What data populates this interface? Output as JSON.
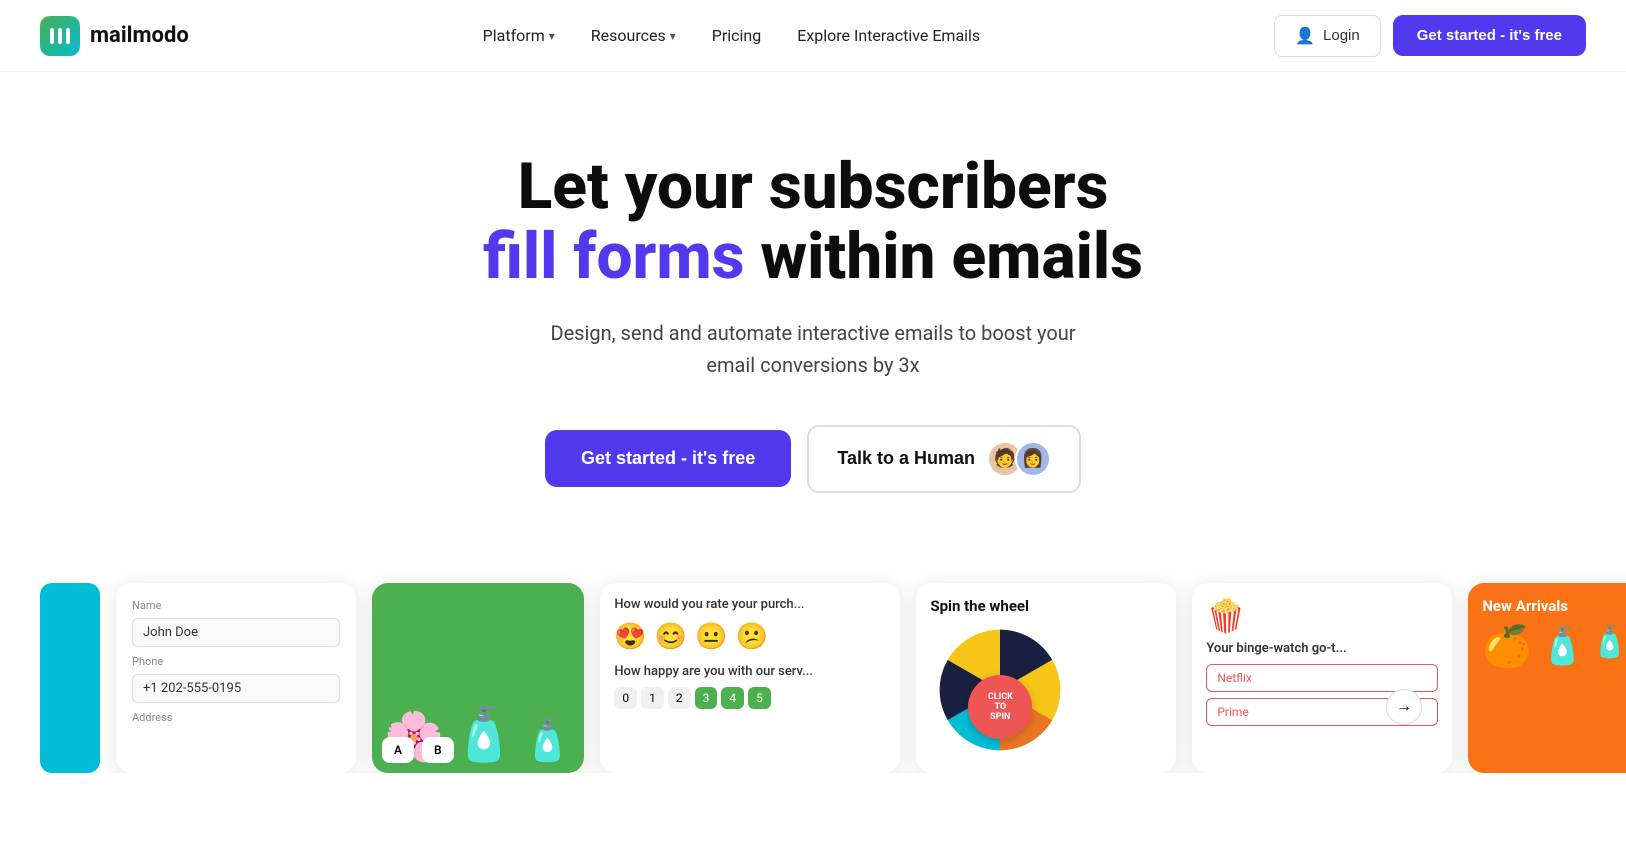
{
  "nav": {
    "logo_text": "mailmodo",
    "links": [
      {
        "label": "Platform",
        "has_dropdown": true
      },
      {
        "label": "Resources",
        "has_dropdown": true
      },
      {
        "label": "Pricing",
        "has_dropdown": false
      },
      {
        "label": "Explore Interactive Emails",
        "has_dropdown": false
      }
    ],
    "login_label": "Login",
    "cta_label": "Get started - it's free"
  },
  "hero": {
    "title_line1": "Let your subscribers",
    "title_highlight": "fill forms",
    "title_line2": "within emails",
    "subtitle": "Design, send and automate interactive emails to boost your email conversions by 3x",
    "cta_primary": "Get started - it's free",
    "cta_secondary": "Talk to a Human"
  },
  "cards": [
    {
      "type": "form",
      "label_name": "Name",
      "value_name": "John Doe",
      "label_phone": "Phone",
      "value_phone": "+1 202-555-0195",
      "label_address": "Address"
    },
    {
      "type": "product",
      "color": "#4CAF50"
    },
    {
      "type": "survey",
      "title": "How would you rate your purch...",
      "subtitle": "How happy are you with our serv..."
    },
    {
      "type": "wheel",
      "title": "Spin the wheel"
    },
    {
      "type": "binge",
      "title": "Your binge-watch go-t...",
      "options": [
        "Netflix",
        "Prime"
      ]
    },
    {
      "type": "arrivals",
      "title": "New Arrivals"
    }
  ],
  "wheel": {
    "click_label": "CLICK",
    "to_label": "TO",
    "spin_label": "SPIN"
  },
  "arrows": {
    "left": "←",
    "right": "→"
  }
}
